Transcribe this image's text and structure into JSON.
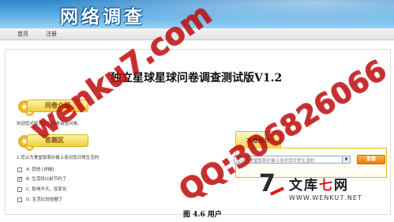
{
  "header": {
    "logo_text": "网络调查"
  },
  "nav": {
    "items": [
      "首页",
      "注册"
    ]
  },
  "page": {
    "title": "独立星球星球问卷调查测试版V1.2"
  },
  "intro_section": {
    "heading": "问卷介绍",
    "text": "欢迎您光临我们的问卷调查问卷。"
  },
  "answer_section": {
    "heading": "答题区",
    "question": "1.您认为食堂饭菜价格上涨对您日常生活的",
    "options": [
      {
        "text": "A. 其他 [详细]",
        "checked": false
      },
      {
        "text": "B. 生活较以前节约了",
        "checked": true
      },
      {
        "text": "C. 影响不大，没变化",
        "checked": false
      },
      {
        "text": "D. 生活比较拮据了",
        "checked": false
      }
    ]
  },
  "stats_section": {
    "heading": "本卷统计",
    "select_value": "您认为食堂饭菜价格上涨对您日常生活的",
    "button_label": "查看"
  },
  "caption": "图  4.6 用户",
  "brand": {
    "name_black": "文库",
    "name_red": "七",
    "name_tail": "网",
    "url": "WWW.WENKU7.NET",
    "accent": "#d71a1a"
  },
  "watermarks": [
    "wenku7.com",
    "QQ:306826066"
  ]
}
